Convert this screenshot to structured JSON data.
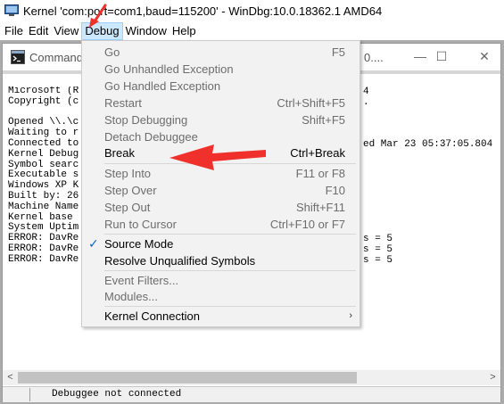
{
  "window": {
    "title": "Kernel 'com:port=com1,baud=115200' - WinDbg:10.0.18362.1 AMD64"
  },
  "menubar": {
    "items": [
      "File",
      "Edit",
      "View",
      "Debug",
      "Window",
      "Help"
    ],
    "active": "Debug"
  },
  "command_window": {
    "title": "Command",
    "title_suffix": "0....",
    "output_lines": [
      "Microsoft (R",
      "Copyright (c",
      "",
      "Opened \\\\.\\c",
      "Waiting to r",
      "Connected to",
      "Kernel Debug",
      "Symbol searc",
      "Executable s",
      "Windows XP K",
      "Built by: 26",
      "Machine Name",
      "Kernel base",
      "System Uptim",
      "ERROR: DavRe",
      "ERROR: DavRe",
      "ERROR: DavRe"
    ],
    "output_right": {
      "line1": "4",
      "line2": ".",
      "line6": "ed Mar 23 05:37:05.804",
      "err1": "s = 5",
      "err2": "s = 5",
      "err3": "s = 5"
    },
    "status": "Debuggee not connected"
  },
  "debug_menu": {
    "items": [
      {
        "label": "Go",
        "shortcut": "F5",
        "enabled": false
      },
      {
        "label": "Go Unhandled Exception",
        "shortcut": "",
        "enabled": false
      },
      {
        "label": "Go Handled Exception",
        "shortcut": "",
        "enabled": false
      },
      {
        "label": "Restart",
        "shortcut": "Ctrl+Shift+F5",
        "enabled": false
      },
      {
        "label": "Stop Debugging",
        "shortcut": "Shift+F5",
        "enabled": false
      },
      {
        "label": "Detach Debuggee",
        "shortcut": "",
        "enabled": false
      },
      {
        "label": "Break",
        "shortcut": "Ctrl+Break",
        "enabled": true
      },
      {
        "label": "Step Into",
        "shortcut": "F11 or F8",
        "enabled": false
      },
      {
        "label": "Step Over",
        "shortcut": "F10",
        "enabled": false
      },
      {
        "label": "Step Out",
        "shortcut": "Shift+F11",
        "enabled": false
      },
      {
        "label": "Run to Cursor",
        "shortcut": "Ctrl+F10 or F7",
        "enabled": false
      },
      {
        "label": "Source Mode",
        "shortcut": "",
        "enabled": true,
        "checked": true
      },
      {
        "label": "Resolve Unqualified Symbols",
        "shortcut": "",
        "enabled": true
      },
      {
        "label": "Event Filters...",
        "shortcut": "",
        "enabled": false
      },
      {
        "label": "Modules...",
        "shortcut": "",
        "enabled": false
      },
      {
        "label": "Kernel Connection",
        "shortcut": "",
        "enabled": true,
        "submenu": true
      }
    ],
    "check_glyph": "✓",
    "submenu_glyph": "›"
  },
  "colors": {
    "annotation_red": "#f0302a",
    "menu_highlight": "#cce8ff",
    "check_blue": "#0a64c8"
  }
}
